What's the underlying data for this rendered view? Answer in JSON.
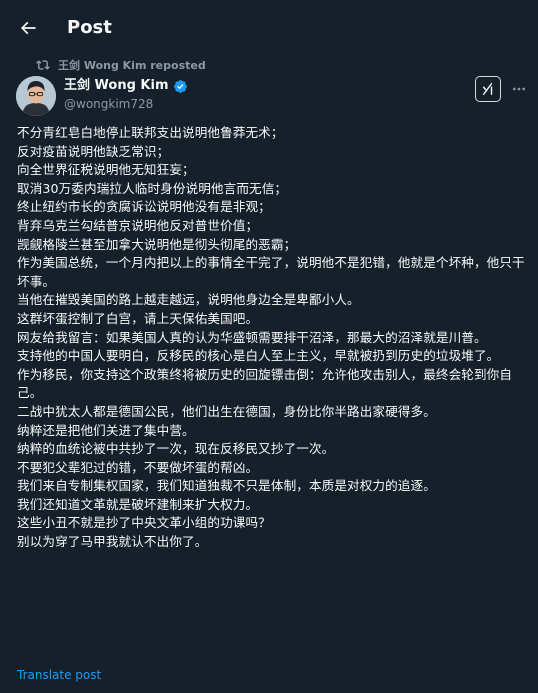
{
  "header": {
    "title": "Post"
  },
  "repost": {
    "label": "王剑 Wong Kim reposted"
  },
  "author": {
    "display_name": "王剑 Wong Kim",
    "handle": "@wongkim728"
  },
  "post": {
    "lines": [
      "不分青红皂白地停止联邦支出说明他鲁莽无术；",
      "反对疫苗说明他缺乏常识；",
      "向全世界征税说明他无知狂妄；",
      "取消30万委内瑞拉人临时身份说明他言而无信；",
      "终止纽约市长的贪腐诉讼说明他没有是非观；",
      "背弃乌克兰勾结普京说明他反对普世价值；",
      "觊觎格陵兰甚至加拿大说明他是彻头彻尾的恶霸；",
      "作为美国总统，一个月内把以上的事情全干完了，说明他不是犯错，他就是个坏种，他只干坏事。",
      "当他在摧毁美国的路上越走越远，说明他身边全是卑鄙小人。",
      "这群坏蛋控制了白宫，请上天保佑美国吧。",
      "网友给我留言：如果美国人真的认为华盛顿需要排干沼泽，那最大的沼泽就是川普。",
      "支持他的中国人要明白，反移民的核心是白人至上主义，早就被扔到历史的垃圾堆了。",
      "作为移民，你支持这个政策终将被历史的回旋镖击倒：允许他攻击别人，最终会轮到你自己。",
      "二战中犹太人都是德国公民，他们出生在德国，身份比你半路出家硬得多。",
      "纳粹还是把他们关进了集中营。",
      "纳粹的血统论被中共抄了一次，现在反移民又抄了一次。",
      "不要犯父辈犯过的错，不要做坏蛋的帮凶。",
      "我们来自专制集权国家，我们知道独裁不只是体制，本质是对权力的追逐。",
      "我们还知道文革就是破坏建制来扩大权力。",
      "这些小丑不就是抄了中央文革小组的功课吗？",
      "别以为穿了马甲我就认不出你了。"
    ],
    "translate_label": "Translate post"
  },
  "icons": {
    "back": "arrow-left-icon",
    "repost": "repost-icon",
    "verified": "verified-badge-icon",
    "grok": "grok-icon",
    "more": "more-icon"
  },
  "colors": {
    "background": "#15202b",
    "text": "#f7f9f9",
    "secondary_text": "#8b98a5",
    "accent": "#1d9bf0"
  }
}
